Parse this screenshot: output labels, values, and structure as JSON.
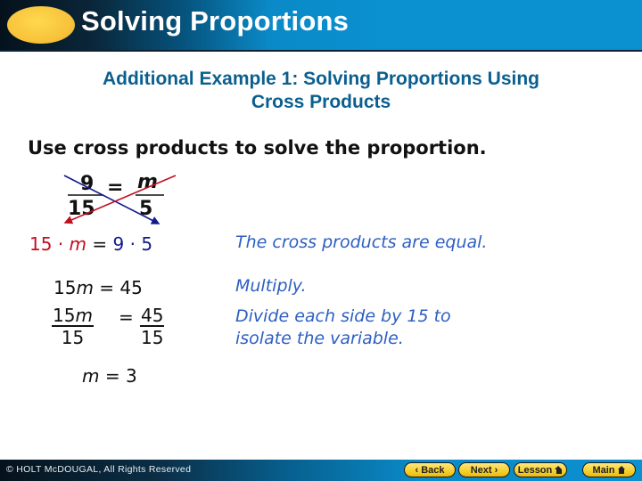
{
  "header": {
    "title": "Solving Proportions"
  },
  "slide": {
    "subtitle_line1": "Additional Example 1: Solving Proportions Using",
    "subtitle_line2": "Cross Products",
    "instruction": "Use cross products to solve the proportion.",
    "proportion": {
      "left_numerator": "9",
      "left_denominator": "15",
      "equals": "=",
      "right_numerator": "m",
      "right_denominator": "5",
      "arrow_colors": {
        "blue": "#101a8a",
        "red": "#c01020"
      }
    },
    "steps": [
      {
        "equation": {
          "left_a": "15",
          "dot1": "·",
          "left_var": "m",
          "eq": "=",
          "right_a": "9",
          "dot2": "·",
          "right_b": "5"
        },
        "note": "The cross products are equal."
      },
      {
        "equation": {
          "coef": "15",
          "var": "m",
          "eq": "=",
          "rhs": "45"
        },
        "note": "Multiply."
      },
      {
        "equation": {
          "num_coef": "15",
          "num_var": "m",
          "den_left": "15",
          "eq": "=",
          "num_right": "45",
          "den_right": "15"
        },
        "note_line1": "Divide each side by 15 to",
        "note_line2": "isolate the variable."
      },
      {
        "equation": {
          "var": "m",
          "eq": "=",
          "rhs": "3"
        }
      }
    ]
  },
  "footer": {
    "copyright": "© HOLT McDOUGAL, All Rights Reserved",
    "nav": {
      "back": "Back",
      "next": "Next",
      "lesson": "Lesson",
      "main": "Main"
    }
  },
  "colors": {
    "header_blue": "#0b90d0",
    "subtitle": "#0b5f8f",
    "note_blue": "#2d5fc2",
    "button_yellow": "#f6cf2a",
    "orb_yellow": "#f7c23a"
  }
}
